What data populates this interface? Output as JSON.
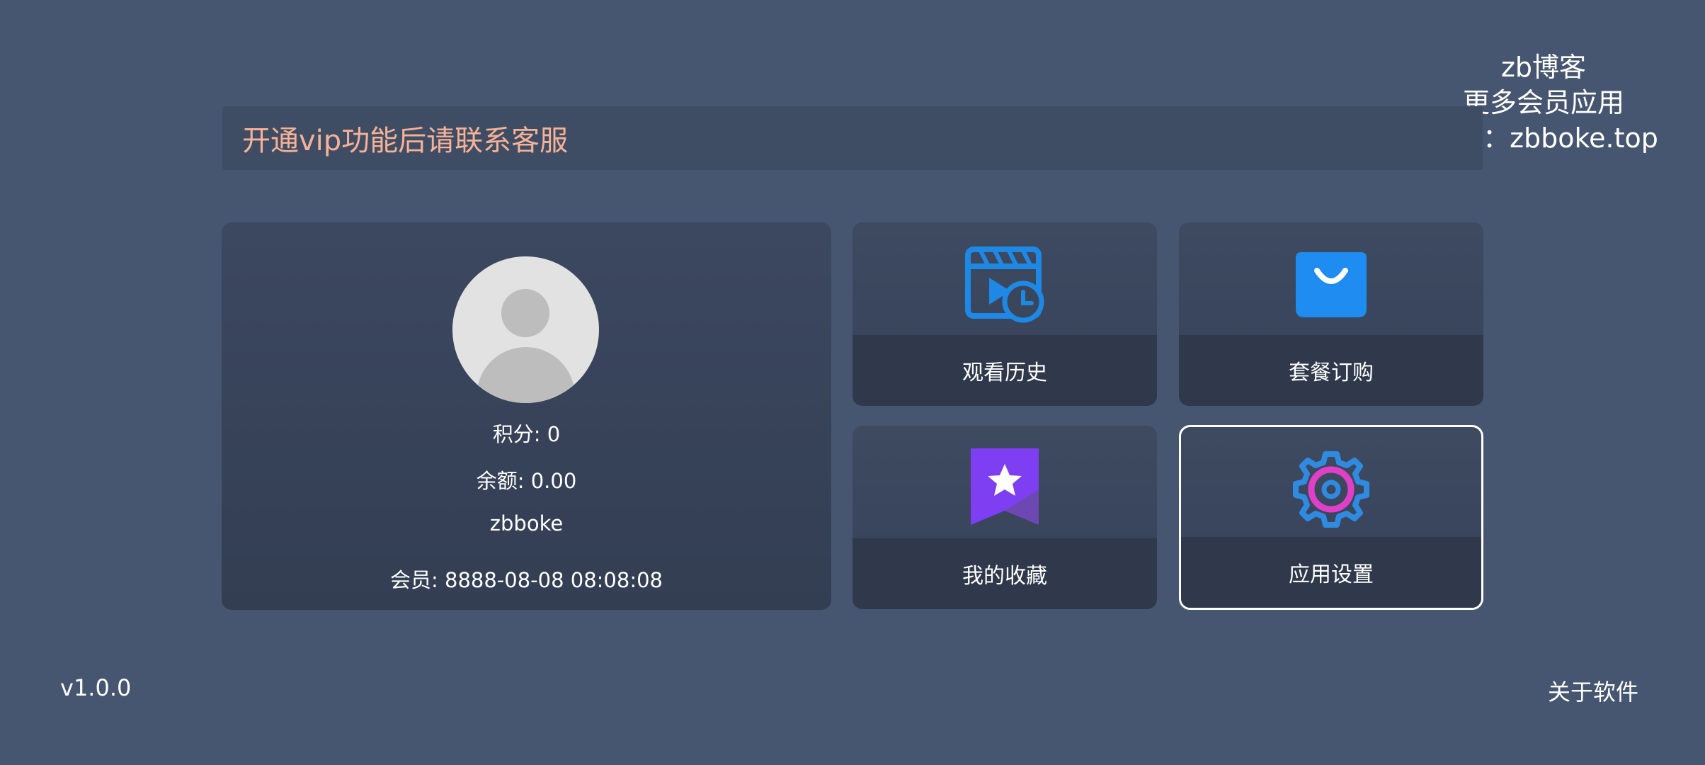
{
  "watermark": {
    "line1": "zb博客",
    "line2": "更多会员应用",
    "line3": "网址：zbboke.top"
  },
  "notice": {
    "text": "开通vip功能后请联系客服",
    "color": "#f5b297"
  },
  "profile": {
    "avatar_icon": "user-avatar-icon",
    "points": "积分: 0",
    "balance": "余额: 0.00",
    "username": "zbboke",
    "membership": "会员: 8888-08-08 08:08:08"
  },
  "menu": {
    "history": {
      "label": "观看历史",
      "icon": "video-history-icon",
      "color": "#1e88e5"
    },
    "package": {
      "label": "套餐订购",
      "icon": "shopping-bag-icon",
      "color": "#1e8cf0"
    },
    "favorite": {
      "label": "我的收藏",
      "icon": "bookmark-star-icon",
      "color": "#7e3ff2"
    },
    "settings": {
      "label": "应用设置",
      "icon": "gear-icon",
      "color": "#2f8ae0",
      "accent": "#e040c8"
    }
  },
  "footer": {
    "version": "v1.0.0",
    "about": "关于软件"
  },
  "colors": {
    "background": "#465670",
    "card": "#3c4860",
    "focus_border": "#ffffff"
  }
}
